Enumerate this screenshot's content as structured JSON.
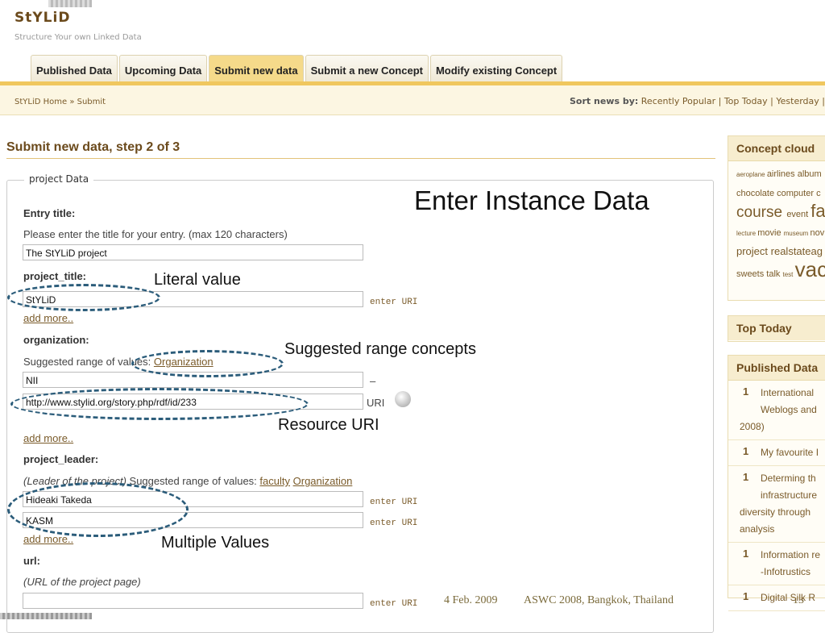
{
  "app": {
    "logo": "StYLiD",
    "tagline": "Structure Your own Linked Data"
  },
  "tabs": [
    "Published Data",
    "Upcoming Data",
    "Submit new data",
    "Submit a new Concept",
    "Modify existing Concept"
  ],
  "breadcrumb": "StYLiD Home » Submit",
  "sort_news": {
    "label": "Sort news by:",
    "options": [
      "Recently Popular",
      "Top Today",
      "Yesterday"
    ]
  },
  "page_title": "Submit new data, step 2 of 3",
  "fieldset_legend": "project Data",
  "slide_title": "Enter Instance Data",
  "form": {
    "entry_title_label": "Entry title:",
    "entry_title_hint": "Please enter the title for your entry. (max 120 characters)",
    "entry_title_value": "The StYLiD project",
    "project_title_label": "project_title:",
    "project_title_value": "StYLiD",
    "enter_uri": "enter URI",
    "add_more": "add more..",
    "organization_label": "organization:",
    "suggested_prefix": "Suggested range of values:",
    "organization_link": "Organization",
    "org_value_1": "NII",
    "org_value_1_suffix": "–",
    "org_value_2": "http://www.stylid.org/story.php/rdf/id/233",
    "uri_label": "URI",
    "project_leader_label": "project_leader:",
    "leader_hint_italic": "(Leader of the project)",
    "leader_suggested": " Suggested range of values: ",
    "leader_link_faculty": "faculty",
    "leader_link_org": "Organization",
    "leader_value_1": "Hideaki Takeda",
    "leader_value_2": "KASM",
    "url_label": "url:",
    "url_hint": "(URL of the project page)",
    "url_value": ""
  },
  "annotations": {
    "literal": "Literal value",
    "suggested": "Suggested range concepts",
    "resource": "Resource URI",
    "multiple": "Multiple Values"
  },
  "footer": {
    "date": "4 Feb. 2009",
    "conference": "ASWC 2008, Bangkok, Thailand",
    "page": "13"
  },
  "sidebar": {
    "concept_cloud": {
      "title": "Concept cloud",
      "line1": [
        {
          "t": "aeroplane",
          "s": 8
        },
        {
          "t": "airlines",
          "s": 11
        },
        {
          "t": "album",
          "s": 11
        }
      ],
      "line2": [
        {
          "t": "chocolate",
          "s": 11
        },
        {
          "t": "computer",
          "s": 11
        },
        {
          "t": "c",
          "s": 11
        }
      ],
      "line3": [
        {
          "t": "course",
          "s": 19
        },
        {
          "t": "event",
          "s": 11
        },
        {
          "t": "fa",
          "s": 22
        }
      ],
      "line4": [
        {
          "t": "lecture",
          "s": 8
        },
        {
          "t": "movie",
          "s": 11
        },
        {
          "t": "museum",
          "s": 8
        },
        {
          "t": "nov",
          "s": 11
        }
      ],
      "line5": [
        {
          "t": "project",
          "s": 13
        },
        {
          "t": "realstateag",
          "s": 13
        }
      ],
      "line6": [
        {
          "t": "sweets",
          "s": 11
        },
        {
          "t": "talk",
          "s": 11
        },
        {
          "t": "test",
          "s": 8
        },
        {
          "t": "vac",
          "s": 26
        }
      ]
    },
    "top_today": "Top Today",
    "published_data": {
      "title": "Published Data",
      "items": [
        {
          "num": "1",
          "lines": [
            "International",
            "Weblogs and",
            "2008)"
          ]
        },
        {
          "num": "1",
          "lines": [
            "My favourite I"
          ]
        },
        {
          "num": "1",
          "lines": [
            "Determing th",
            "infrastructure",
            "diversity through",
            "analysis"
          ]
        },
        {
          "num": "1",
          "lines": [
            "Information re",
            "-Infotrustics"
          ]
        },
        {
          "num": "1",
          "lines": [
            "Digital Silk R"
          ]
        }
      ]
    }
  }
}
